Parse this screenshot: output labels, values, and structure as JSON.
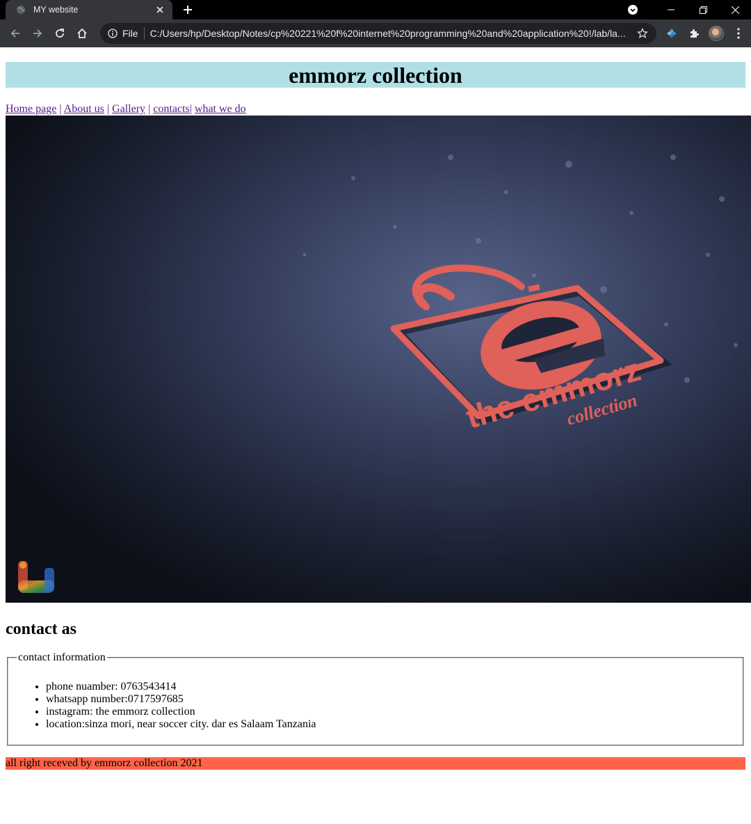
{
  "browser": {
    "tab_title": "MY website",
    "scheme_label": "File",
    "url": "C:/Users/hp/Desktop/Notes/cp%20221%20f%20internet%20programming%20and%20application%20!/lab/la..."
  },
  "site": {
    "title": "emmorz collection",
    "nav": [
      {
        "label": "Home page"
      },
      {
        "label": "About us"
      },
      {
        "label": "Gallery"
      },
      {
        "label": "contacts"
      },
      {
        "label": "what we do"
      }
    ],
    "hero": {
      "logo_top_text": "the emmorz",
      "logo_sub_text": "collection"
    },
    "contact_heading": "contact as",
    "legend": "contact information",
    "contacts": [
      "phone nuamber: 0763543414",
      "whatsapp number:0717597685",
      "instagram: the emmorz collection",
      "location:sinza mori, near soccer city. dar es Salaam Tanzania"
    ],
    "footer": "all right receved by emmorz collection 2021"
  },
  "colors": {
    "header_bg": "#b0e0e6",
    "footer_bg": "#ff6347",
    "logo_red": "#e0605a",
    "link": "#551a8b"
  }
}
